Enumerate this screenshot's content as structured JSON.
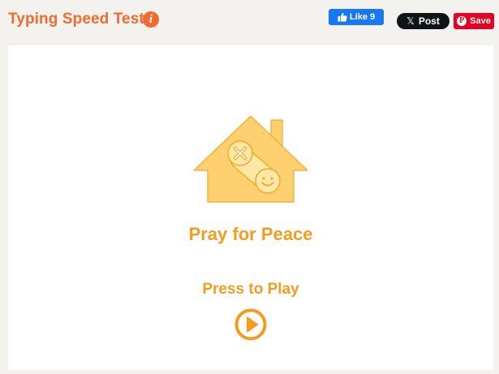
{
  "header": {
    "title": "Typing Speed Test",
    "info_icon": "info-icon",
    "facebook": {
      "label": "Like",
      "count": "9",
      "icon": "thumbs-up-icon"
    },
    "x": {
      "logo": "𝕏",
      "label": "Post"
    },
    "pinterest": {
      "logo": "P",
      "label": "Save"
    }
  },
  "stage": {
    "logo_icon": "house-gamepad-icon",
    "message": "Pray for Peace",
    "play_label": "Press to Play",
    "play_icon": "play-circle-icon"
  },
  "colors": {
    "title_orange": "#f26b2e",
    "accent_orange": "#f39c1e",
    "house_fill": "#ffd070",
    "facebook_blue": "#1877f2",
    "x_black": "#0f1419",
    "pinterest_red": "#e60023"
  }
}
